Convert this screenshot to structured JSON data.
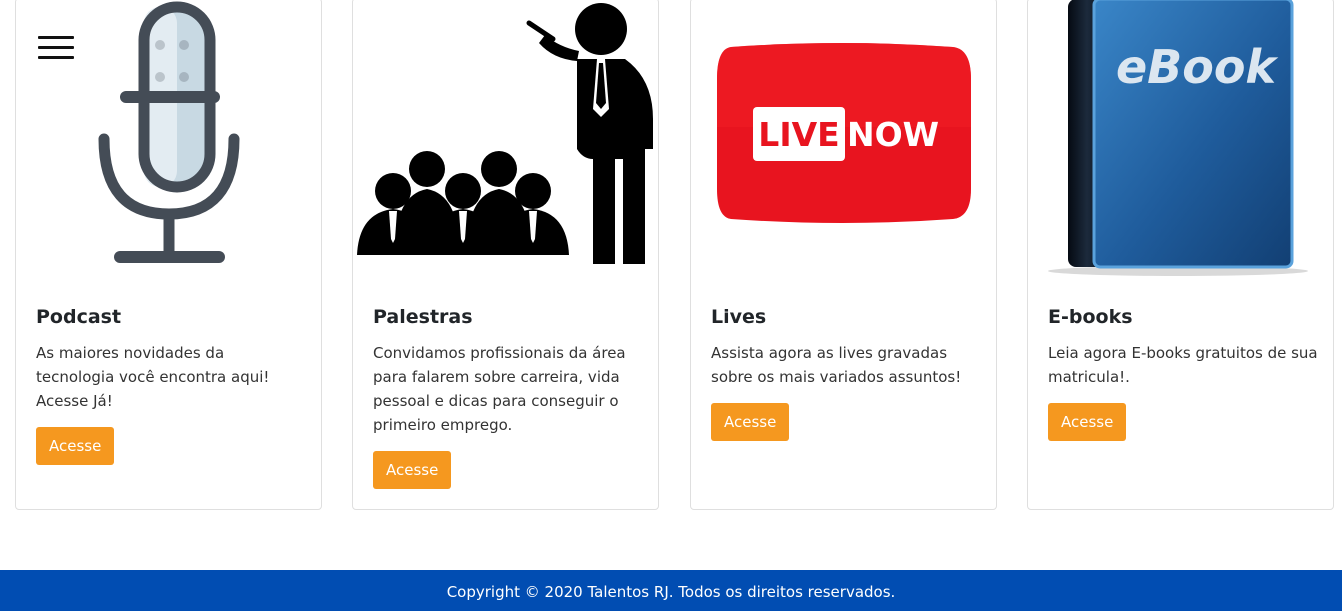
{
  "nav": {
    "menu_icon": "hamburger-menu-icon"
  },
  "cards": [
    {
      "image_icon": "microphone-icon",
      "title": "Podcast",
      "text": "As maiores novidades da tecnologia você encontra aqui! Acesse Já!",
      "button_label": "Acesse"
    },
    {
      "image_icon": "speaker-audience-icon",
      "title": "Palestras",
      "text": "Convidamos profissionais da área para falarem sobre carreira, vida pessoal e dicas para conseguir o primeiro emprego.",
      "button_label": "Acesse"
    },
    {
      "image_icon": "live-now-icon",
      "image_text": {
        "live": "LIVE",
        "now": "NOW"
      },
      "title": "Lives",
      "text": "Assista agora as lives gravadas sobre os mais variados assuntos!",
      "button_label": "Acesse"
    },
    {
      "image_icon": "ebook-icon",
      "image_text": "eBook",
      "title": "E-books",
      "text": "Leia agora E-books gratuitos de sua matricula!.",
      "button_label": "Acesse"
    }
  ],
  "footer": {
    "text": "Copyright © 2020 Talentos RJ. Todos os direitos reservados."
  },
  "colors": {
    "button": "#f5981f",
    "footer": "#014db2",
    "live_red": "#e8141f",
    "ebook_blue": "#1f5c9c"
  }
}
